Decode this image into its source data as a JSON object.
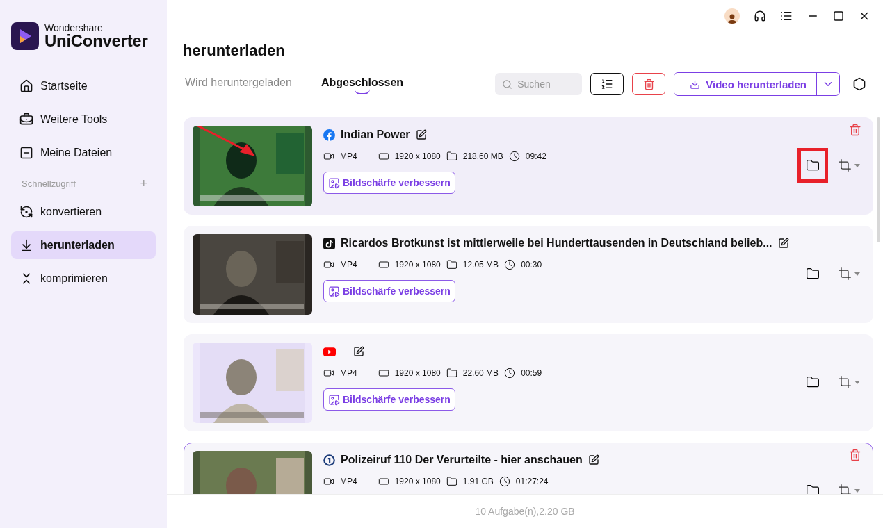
{
  "app": {
    "brand_top": "Wondershare",
    "brand_name": "UniConverter"
  },
  "sidebar": {
    "items": [
      {
        "kind": "home",
        "label": "Startseite",
        "selected": false
      },
      {
        "kind": "tools",
        "label": "Weitere Tools",
        "selected": false
      },
      {
        "kind": "files",
        "label": "Meine Dateien",
        "selected": false
      }
    ],
    "section": {
      "label": "Schnellzugriff",
      "add": "+"
    },
    "quick_items": [
      {
        "kind": "convert",
        "label": "konvertieren",
        "selected": false
      },
      {
        "kind": "download",
        "label": "herunterladen",
        "selected": true
      },
      {
        "kind": "compress",
        "label": "komprimieren",
        "selected": false
      }
    ]
  },
  "page_title": "herunterladen",
  "tabs": [
    {
      "label": "Wird heruntergeladen",
      "selected": false
    },
    {
      "label": "Abgeschlossen",
      "selected": true
    }
  ],
  "search": {
    "placeholder": "Suchen"
  },
  "download_button": "Video herunterladen",
  "items": [
    {
      "kind": "facebook",
      "title": "Indian Power",
      "format": "MP4",
      "resolution": "1920 x 1080",
      "size": "218.60 MB",
      "duration": "09:42",
      "enhance": "Bildschärfe verbessern",
      "hovered": true,
      "selected": false,
      "folder_highlighted": true,
      "pointer_arrow": true
    },
    {
      "kind": "tiktok",
      "title": "Ricardos Brotkunst ist mittlerweile bei Hunderttausenden in Deutschland belieb...",
      "format": "MP4",
      "resolution": "1920 x 1080",
      "size": "12.05 MB",
      "duration": "00:30",
      "enhance": "Bildschärfe verbessern",
      "hovered": false,
      "selected": false,
      "folder_highlighted": false,
      "pointer_arrow": false
    },
    {
      "kind": "youtube",
      "title": "_",
      "format": "MP4",
      "resolution": "1920 x 1080",
      "size": "22.60 MB",
      "duration": "00:59",
      "enhance": "Bildschärfe verbessern",
      "hovered": false,
      "selected": false,
      "folder_highlighted": false,
      "pointer_arrow": false
    },
    {
      "kind": "ard",
      "title": "Polizeiruf 110 Der Verurteilte - hier anschauen",
      "format": "MP4",
      "resolution": "1920 x 1080",
      "size": "1.91 GB",
      "duration": "01:27:24",
      "hovered": false,
      "selected": true,
      "folder_highlighted": false,
      "pointer_arrow": false
    }
  ],
  "status_bar": "10 Aufgabe(n),2.20 GB"
}
